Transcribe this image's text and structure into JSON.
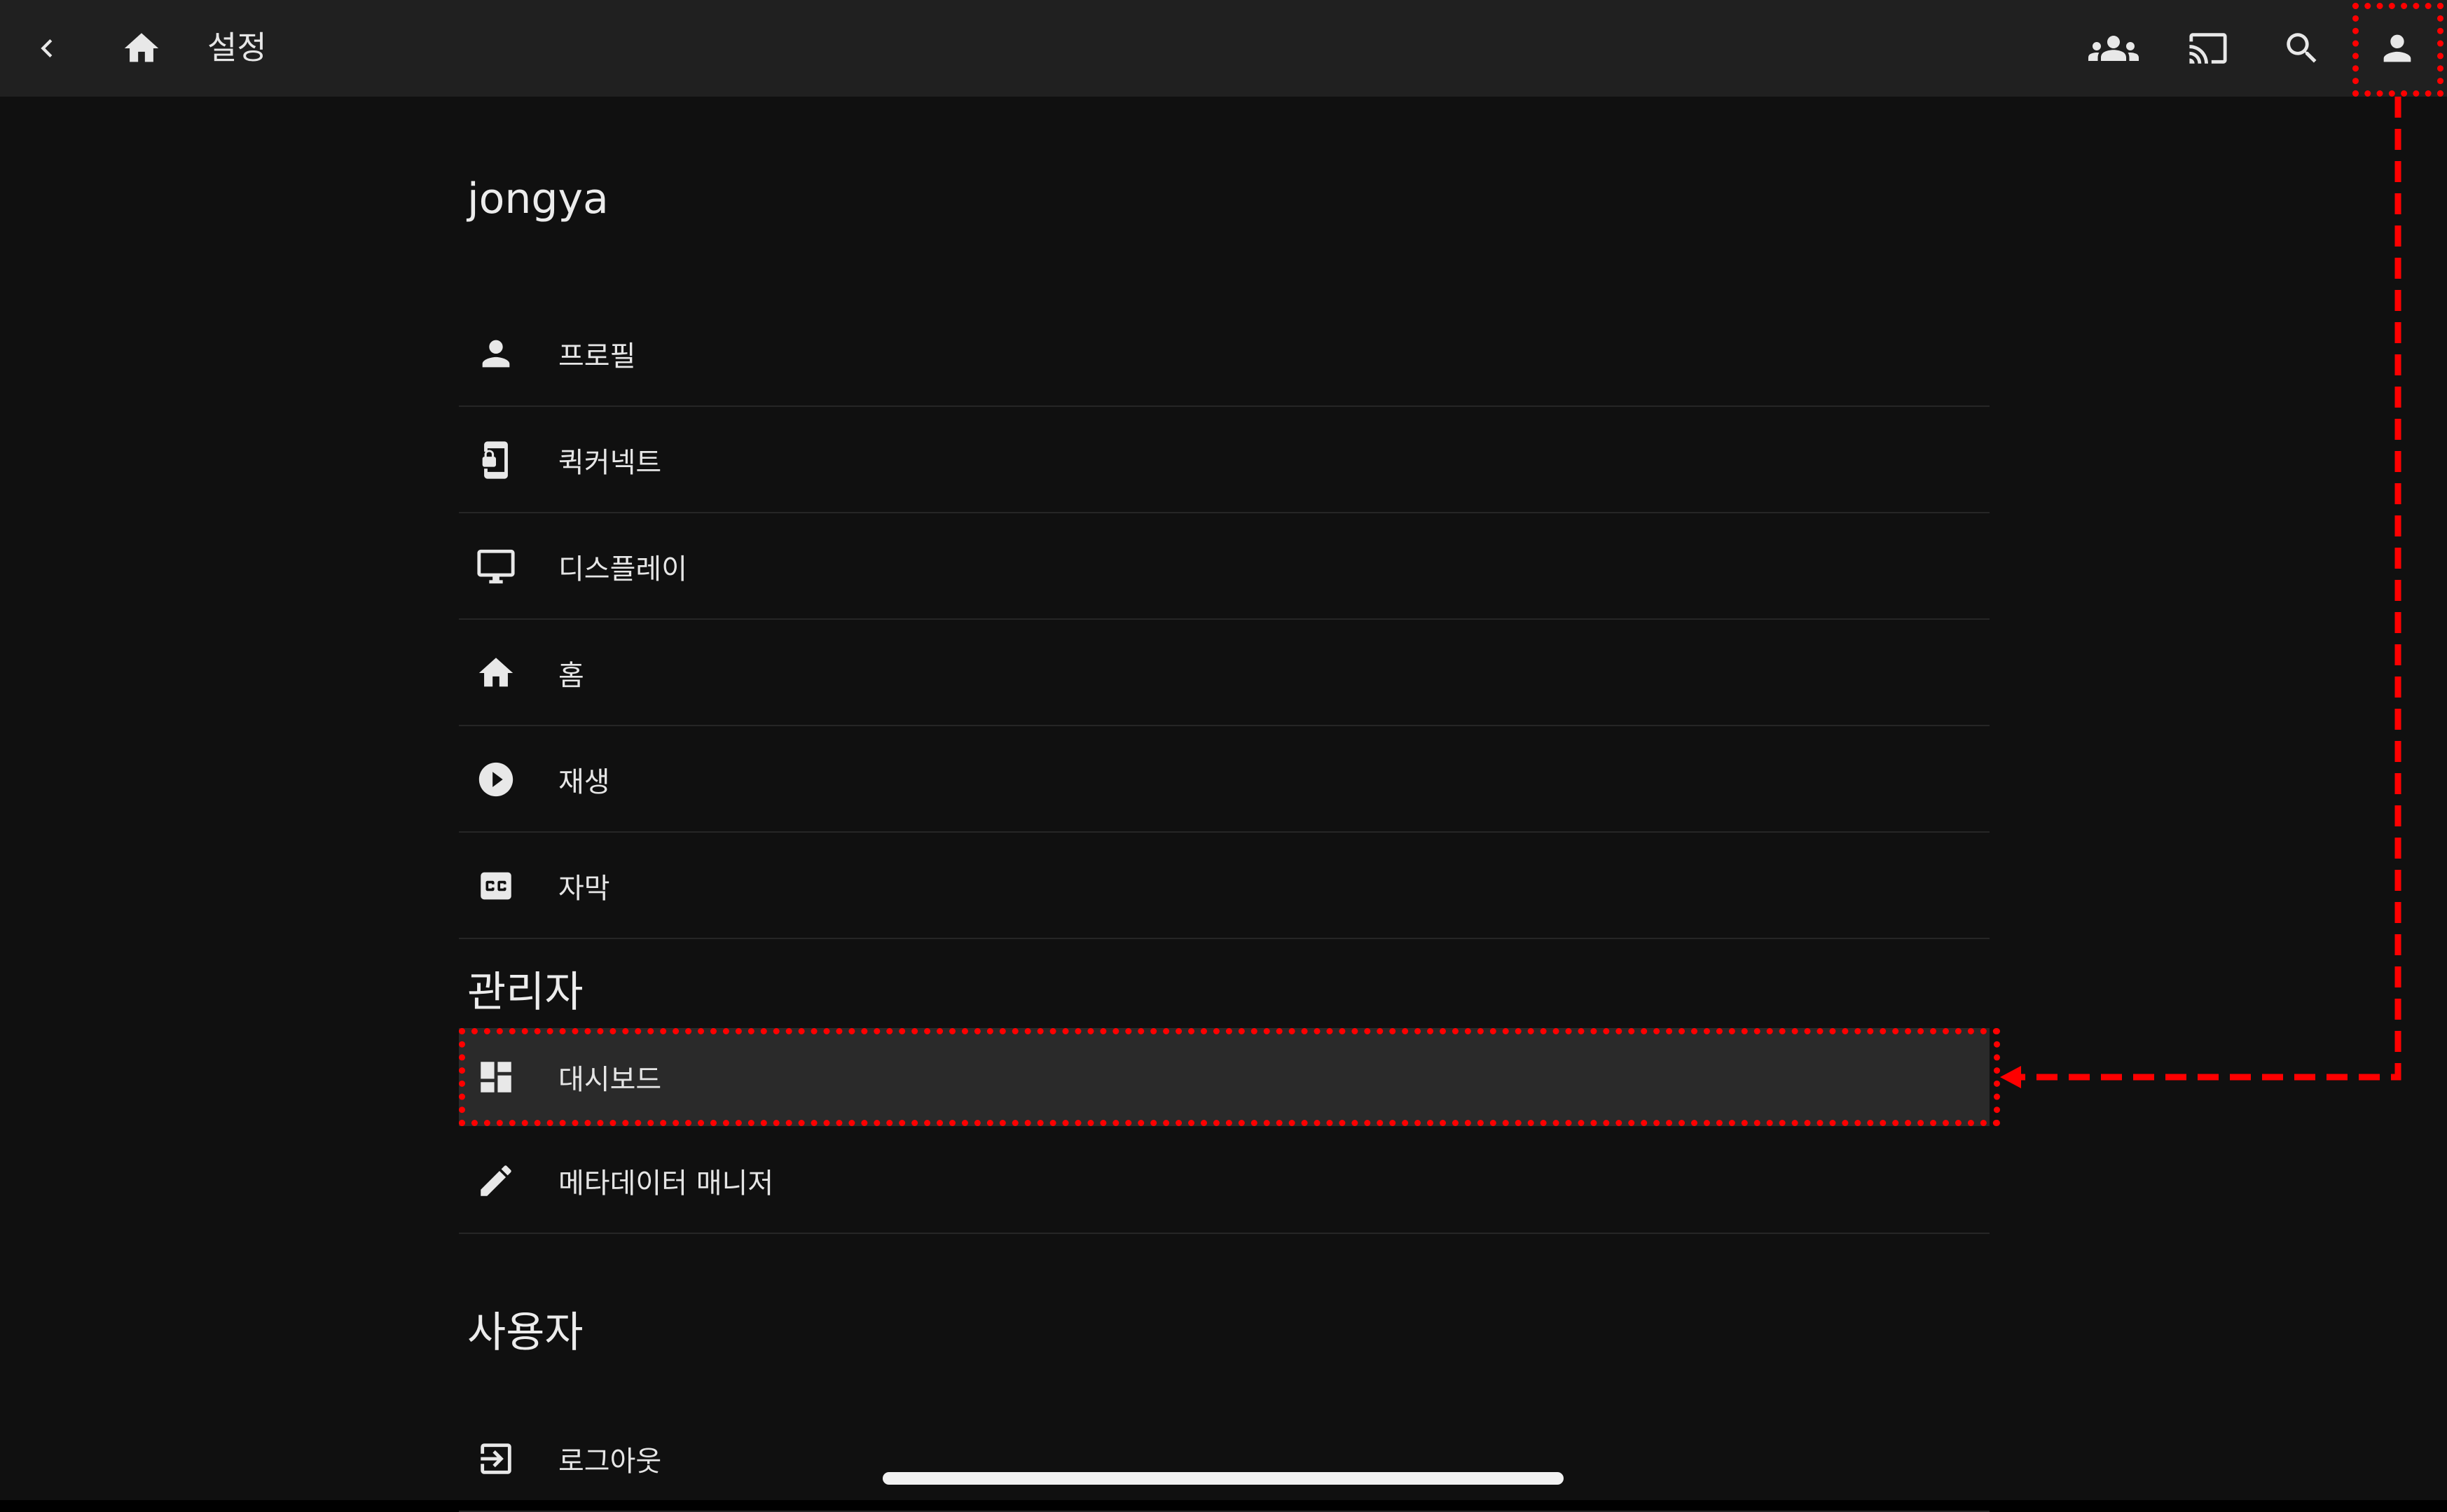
{
  "topbar": {
    "title": "설정",
    "icons": [
      "back-chevron",
      "home",
      "sync-play-users",
      "cast",
      "search",
      "account"
    ]
  },
  "sections": [
    {
      "title": "jongya",
      "items": [
        {
          "label": "프로필",
          "icon": "person"
        },
        {
          "label": "퀵커넥트",
          "icon": "phone-lock"
        },
        {
          "label": "디스플레이",
          "icon": "monitor"
        },
        {
          "label": "홈",
          "icon": "home"
        },
        {
          "label": "재생",
          "icon": "play-circle"
        },
        {
          "label": "자막",
          "icon": "closed-caption"
        }
      ]
    },
    {
      "title": "관리자",
      "items": [
        {
          "label": "대시보드",
          "icon": "dashboard"
        },
        {
          "label": "메타데이터 매니저",
          "icon": "pencil"
        }
      ]
    },
    {
      "title": "사용자",
      "items": [
        {
          "label": "로그아웃",
          "icon": "logout"
        }
      ]
    }
  ],
  "colors": {
    "background": "#101010",
    "topbar": "#202020",
    "highlight_row": "#2a2a2a",
    "annotation": "#ff0000",
    "text": "#e6e6e6"
  }
}
